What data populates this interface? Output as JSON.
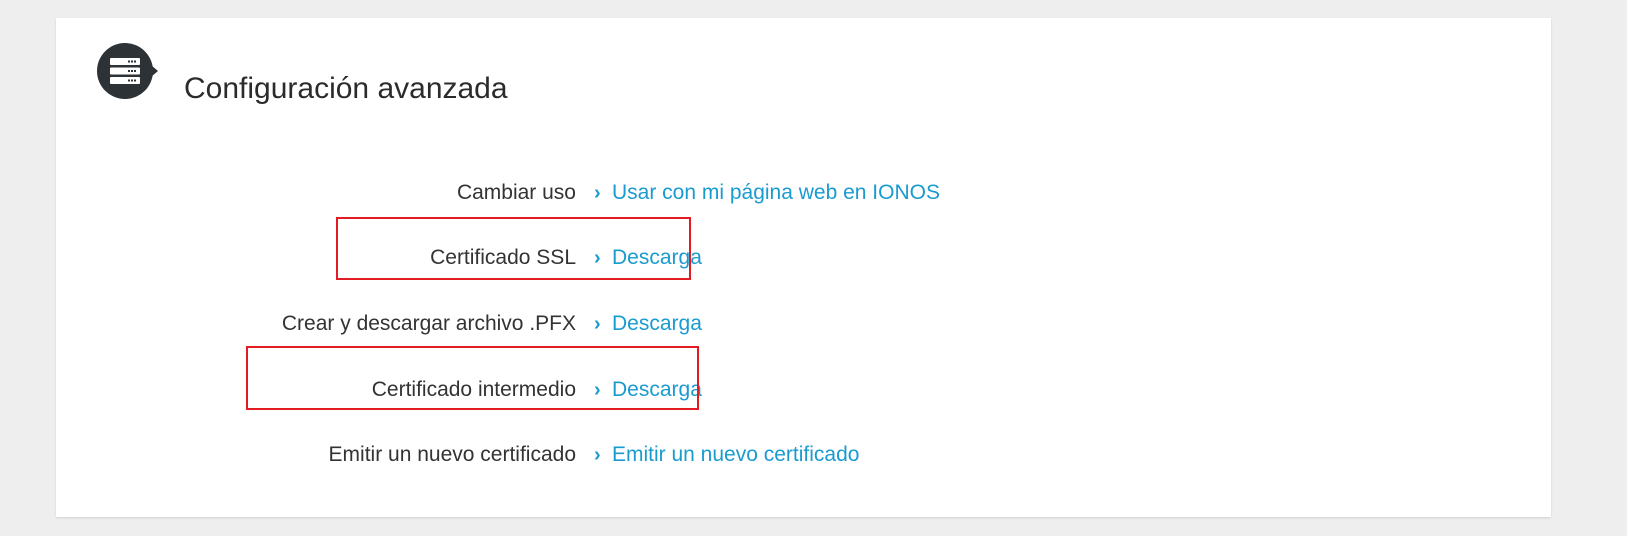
{
  "section": {
    "title": "Configuración avanzada",
    "icon": "server-rack-icon"
  },
  "rows": [
    {
      "label": "Cambiar uso",
      "link": "Usar con mi página web en IONOS"
    },
    {
      "label": "Certificado SSL",
      "link": "Descarga"
    },
    {
      "label": "Crear y descargar archivo .PFX",
      "link": "Descarga"
    },
    {
      "label": "Certificado intermedio",
      "link": "Descarga"
    },
    {
      "label": "Emitir un nuevo certificado",
      "link": "Emitir un nuevo certificado"
    }
  ],
  "link_chevron": "›",
  "colors": {
    "background": "#eeeeee",
    "card": "#ffffff",
    "link": "#1a9bd0",
    "label": "#333333",
    "icon": "#2d3236",
    "highlight": "#e31b23"
  }
}
